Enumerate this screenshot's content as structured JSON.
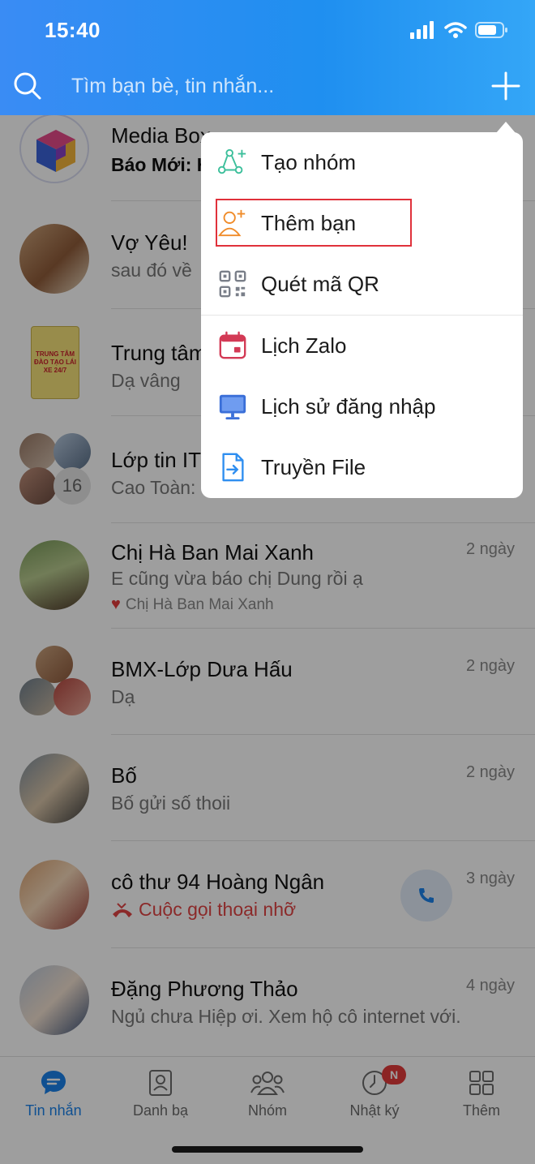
{
  "status_bar": {
    "time": "15:40"
  },
  "search": {
    "placeholder": "Tìm bạn bè, tin nhắn..."
  },
  "chats": [
    {
      "name": "Media Box",
      "preview": "Báo Mới: H",
      "time": ""
    },
    {
      "name": "Vợ Yêu!",
      "preview": "sau đó về",
      "time": ""
    },
    {
      "name": "Trung tâm",
      "preview": "Dạ vâng",
      "time": "",
      "avatar_text": "TRUNG TÂM ĐÀO TẠO LÁI XE 24/7"
    },
    {
      "name": "Lớp tin IT",
      "preview": "Cao Toàn:",
      "time": "",
      "group_count": "16"
    },
    {
      "name": "Chị Hà Ban Mai Xanh",
      "preview": "E cũng vừa báo chị Dung rồi ạ",
      "time": "2 ngày",
      "reaction_by": "Chị Hà Ban Mai Xanh"
    },
    {
      "name": "BMX-Lớp Dưa Hấu",
      "preview": "Dạ",
      "time": "2 ngày"
    },
    {
      "name": "Bố",
      "preview": "Bố gửi số thoii",
      "time": "2 ngày"
    },
    {
      "name": "cô thư 94 Hoàng Ngân",
      "preview": "Cuộc gọi thoại nhỡ",
      "time": "3 ngày"
    },
    {
      "name": "Đặng Phương Thảo",
      "preview": "Ngủ chưa Hiệp ơi. Xem hộ cô internet với.",
      "time": "4 ngày"
    }
  ],
  "menu": {
    "items": [
      {
        "label": "Tạo nhóm",
        "icon": "create-group-icon"
      },
      {
        "label": "Thêm bạn",
        "icon": "add-friend-icon"
      },
      {
        "label": "Quét mã QR",
        "icon": "qr-code-icon"
      },
      {
        "label": "Lịch Zalo",
        "icon": "calendar-icon"
      },
      {
        "label": "Lịch sử đăng nhập",
        "icon": "monitor-icon"
      },
      {
        "label": "Truyền File",
        "icon": "file-transfer-icon"
      }
    ]
  },
  "bottom_nav": {
    "items": [
      {
        "label": "Tin nhắn",
        "icon": "chat-icon",
        "active": true
      },
      {
        "label": "Danh bạ",
        "icon": "contacts-icon"
      },
      {
        "label": "Nhóm",
        "icon": "group-icon"
      },
      {
        "label": "Nhật ký",
        "icon": "clock-icon",
        "badge": "N"
      },
      {
        "label": "Thêm",
        "icon": "grid-icon"
      }
    ]
  },
  "colors": {
    "header": "#1f8ff0",
    "active": "#1a82ea",
    "missed_call": "#e14545",
    "highlight": "#e0313b"
  }
}
